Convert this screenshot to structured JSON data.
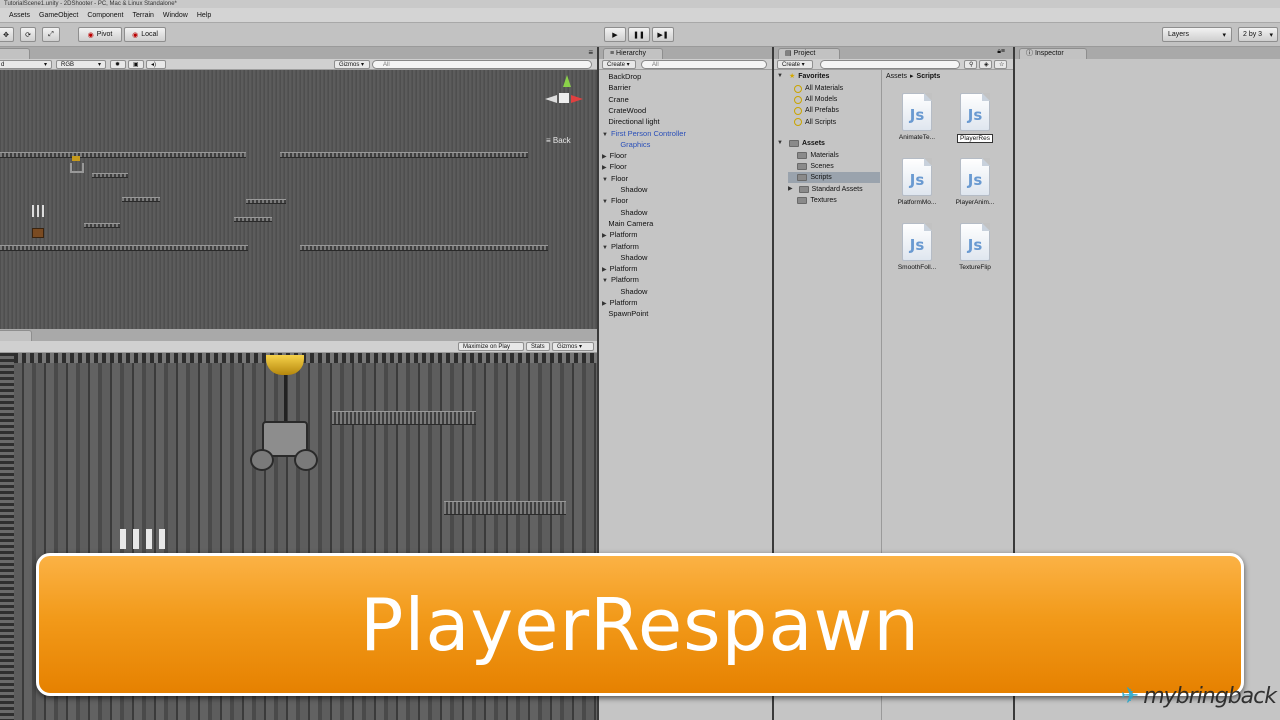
{
  "window": {
    "title": "TutorialScene1.unity - 2DShooter - PC, Mac & Linux Standalone*"
  },
  "menu": [
    "Assets",
    "GameObject",
    "Component",
    "Terrain",
    "Window",
    "Help"
  ],
  "toolbar": {
    "pivot": "Pivot",
    "local": "Local",
    "layers": "Layers",
    "layout": "2 by 3"
  },
  "scene": {
    "render_mode": "d",
    "color_mode": "RGB",
    "gizmos": "Gizmos",
    "search_placeholder": "All",
    "back_label": "Back"
  },
  "game": {
    "maximize": "Maximize on Play",
    "stats": "Stats",
    "gizmos": "Gizmos"
  },
  "hierarchy": {
    "tab": "Hierarchy",
    "create": "Create",
    "search_placeholder": "All",
    "items": [
      {
        "label": "BackDrop",
        "arrow": "",
        "indent": 0
      },
      {
        "label": "Barrier",
        "arrow": "",
        "indent": 0
      },
      {
        "label": "Crane",
        "arrow": "",
        "indent": 0
      },
      {
        "label": "CrateWood",
        "arrow": "",
        "indent": 0
      },
      {
        "label": "Directional light",
        "arrow": "",
        "indent": 0
      },
      {
        "label": "First Person Controller",
        "arrow": "▼",
        "indent": 0,
        "selected": true
      },
      {
        "label": "Graphics",
        "arrow": "",
        "indent": 1,
        "selected": true
      },
      {
        "label": "Floor",
        "arrow": "▶",
        "indent": 0
      },
      {
        "label": "Floor",
        "arrow": "▶",
        "indent": 0
      },
      {
        "label": "Floor",
        "arrow": "▼",
        "indent": 0
      },
      {
        "label": "Shadow",
        "arrow": "",
        "indent": 1
      },
      {
        "label": "Floor",
        "arrow": "▼",
        "indent": 0
      },
      {
        "label": "Shadow",
        "arrow": "",
        "indent": 1
      },
      {
        "label": "Main Camera",
        "arrow": "",
        "indent": 0
      },
      {
        "label": "Platform",
        "arrow": "▶",
        "indent": 0
      },
      {
        "label": "Platform",
        "arrow": "▼",
        "indent": 0
      },
      {
        "label": "Shadow",
        "arrow": "",
        "indent": 1
      },
      {
        "label": "Platform",
        "arrow": "▶",
        "indent": 0
      },
      {
        "label": "Platform",
        "arrow": "▼",
        "indent": 0
      },
      {
        "label": "Shadow",
        "arrow": "",
        "indent": 1
      },
      {
        "label": "Platform",
        "arrow": "▶",
        "indent": 0
      },
      {
        "label": "SpawnPoint",
        "arrow": "",
        "indent": 0
      }
    ]
  },
  "project": {
    "tab": "Project",
    "create": "Create",
    "favorites_label": "Favorites",
    "favorites": [
      "All Materials",
      "All Models",
      "All Prefabs",
      "All Scripts"
    ],
    "assets_label": "Assets",
    "folders": [
      "Materials",
      "Scenes",
      "Scripts",
      "Standard Assets",
      "Textures"
    ],
    "breadcrumb": [
      "Assets",
      "Scripts"
    ],
    "files": [
      "AnimateTe...",
      "PlayerRes",
      "PlatformMo...",
      "PlayerAnim...",
      "SmoothFoll...",
      "TextureFlip"
    ]
  },
  "inspector": {
    "tab": "Inspector"
  },
  "banner": {
    "text": "PlayerRespawn"
  },
  "watermark": {
    "text": "mybringback"
  }
}
